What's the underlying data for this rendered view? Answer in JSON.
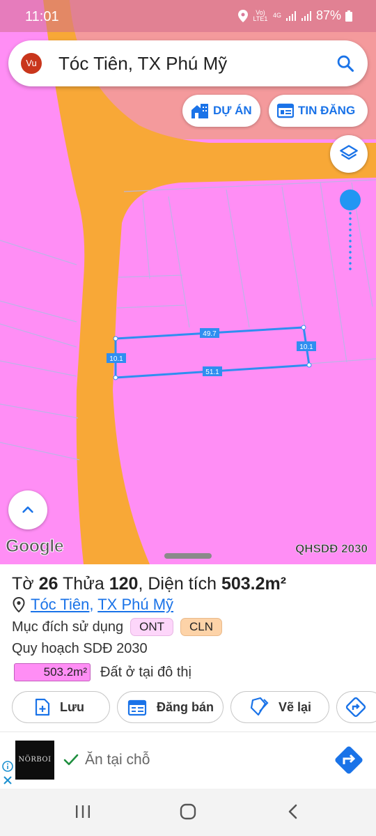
{
  "status_bar": {
    "time": "11:01",
    "volte": "Vo) LTE1",
    "network": "4G",
    "battery": "87%"
  },
  "search": {
    "avatar_initials": "Vu",
    "query": "Tóc Tiên, TX Phú Mỹ",
    "icon": "search-icon"
  },
  "chips": {
    "project_label": "DỰ ÁN",
    "listing_label": "TIN ĐĂNG"
  },
  "map": {
    "edge_labels": {
      "top": "49.7",
      "right": "10.1",
      "bottom": "51.1",
      "left": "10.1"
    },
    "watermark": "Google",
    "layer_name": "QHSDĐ 2030",
    "colors": {
      "residential": "#ff8ef5",
      "road": "#f8a837",
      "parcel_outline": "#2f8ef0",
      "top_right_zone": "#f49a9c"
    }
  },
  "parcel": {
    "sheet_label": "Tờ",
    "sheet_no": "26",
    "plot_label": "Thửa",
    "plot_no": "120",
    "area_label": "Diện tích",
    "area": "503.2m²",
    "ward": "Tóc Tiên",
    "separator": ",",
    "town": "TX Phú Mỹ",
    "purpose_label": "Mục đích sử dụng",
    "purpose_tags": [
      "ONT",
      "CLN"
    ],
    "plan_title": "Quy hoạch SDĐ 2030",
    "plan_area": "503.2m²",
    "plan_use": "Đất ở tại đô thị"
  },
  "actions": {
    "save": "Lưu",
    "sell": "Đăng bán",
    "redraw": "Vẽ lại"
  },
  "ad": {
    "brand": "NÖRBOI",
    "text": "Ăn tại chỗ"
  }
}
